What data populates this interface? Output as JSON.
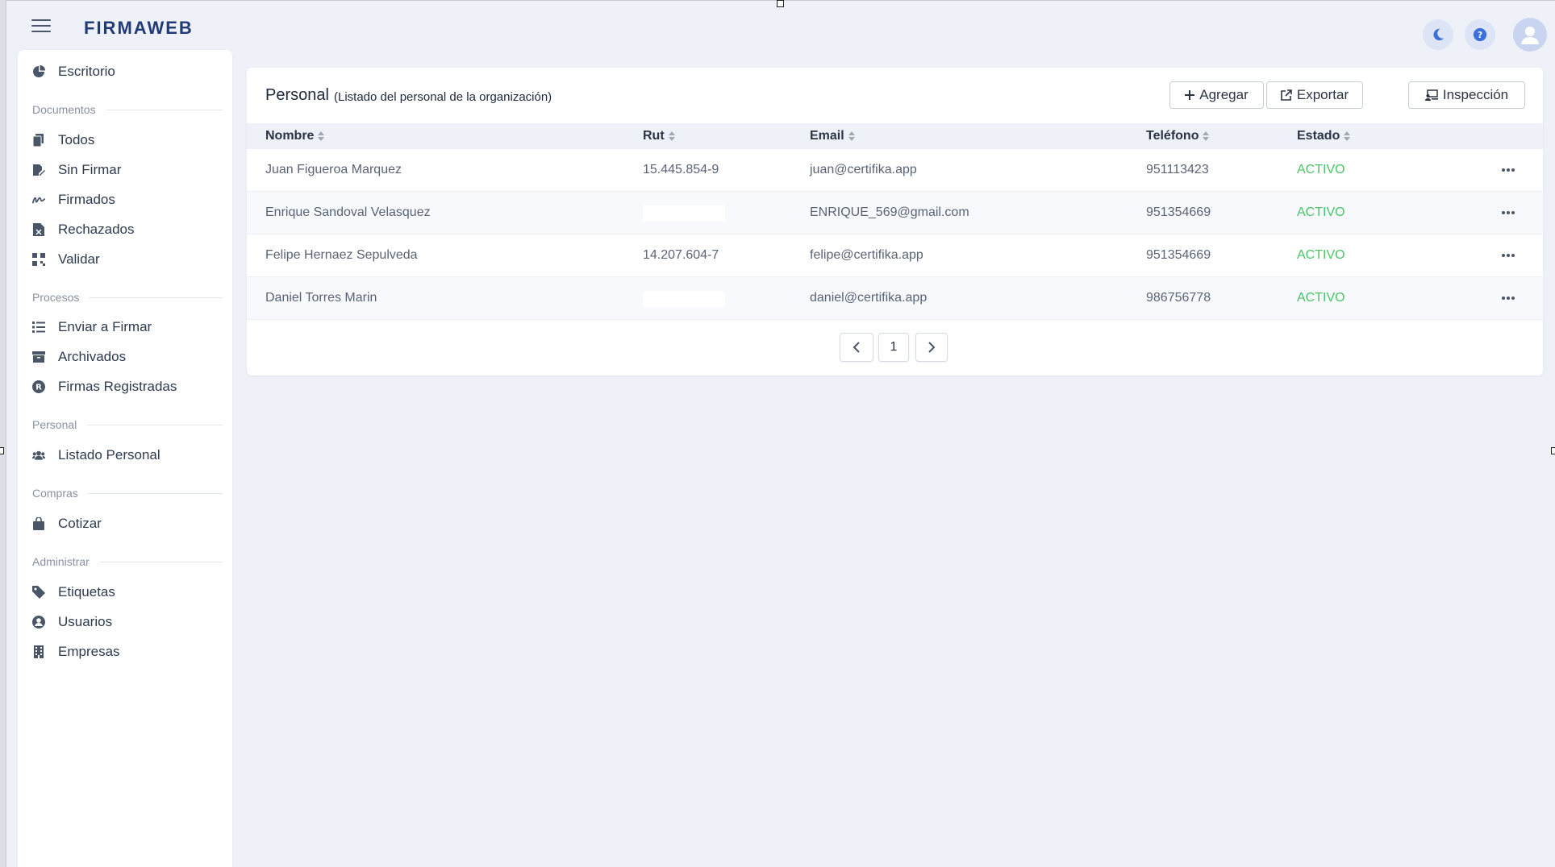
{
  "app": {
    "logo": "FIRMAWEB"
  },
  "topbar": {
    "icons": [
      "hamburger-menu-icon",
      "moon-icon",
      "help-icon",
      "user-avatar-icon"
    ]
  },
  "sidebar": {
    "escritorio": "Escritorio",
    "sections": {
      "documentos": "Documentos",
      "procesos": "Procesos",
      "personal": "Personal",
      "compras": "Compras",
      "administrar": "Administrar"
    },
    "items": {
      "todos": "Todos",
      "sin_firmar": "Sin Firmar",
      "firmados": "Firmados",
      "rechazados": "Rechazados",
      "validar": "Validar",
      "enviar_a_firmar": "Enviar a Firmar",
      "archivados": "Archivados",
      "firmas_registradas": "Firmas Registradas",
      "listado_personal": "Listado Personal",
      "cotizar": "Cotizar",
      "etiquetas": "Etiquetas",
      "usuarios": "Usuarios",
      "empresas": "Empresas"
    }
  },
  "main": {
    "title": "Personal",
    "subtitle": "(Listado del personal de la organización)",
    "buttons": {
      "add": "Agregar",
      "export": "Exportar",
      "inspection": "Inspección"
    },
    "columns": [
      "Nombre",
      "Rut",
      "Email",
      "Teléfono",
      "Estado"
    ],
    "rows": [
      {
        "nombre": "Juan Figueroa Marquez",
        "rut": "15.445.854-9",
        "email": "juan@certifika.app",
        "telefono": "951113423",
        "estado": "ACTIVO"
      },
      {
        "nombre": "Enrique Sandoval Velasquez",
        "rut": "",
        "email": "ENRIQUE_569@gmail.com",
        "telefono": "951354669",
        "estado": "ACTIVO"
      },
      {
        "nombre": "Felipe Hernaez Sepulveda",
        "rut": "14.207.604-7",
        "email": "felipe@certifika.app",
        "telefono": "951354669",
        "estado": "ACTIVO"
      },
      {
        "nombre": "Daniel Torres Marin",
        "rut": "",
        "email": "daniel@certifika.app",
        "telefono": "986756778",
        "estado": "ACTIVO"
      }
    ],
    "pagination": {
      "current_page": "1"
    }
  },
  "colors": {
    "accent": "#3b6fd9",
    "status_active": "#4cc36a",
    "background": "#eef1f8",
    "logo": "#233a79"
  }
}
